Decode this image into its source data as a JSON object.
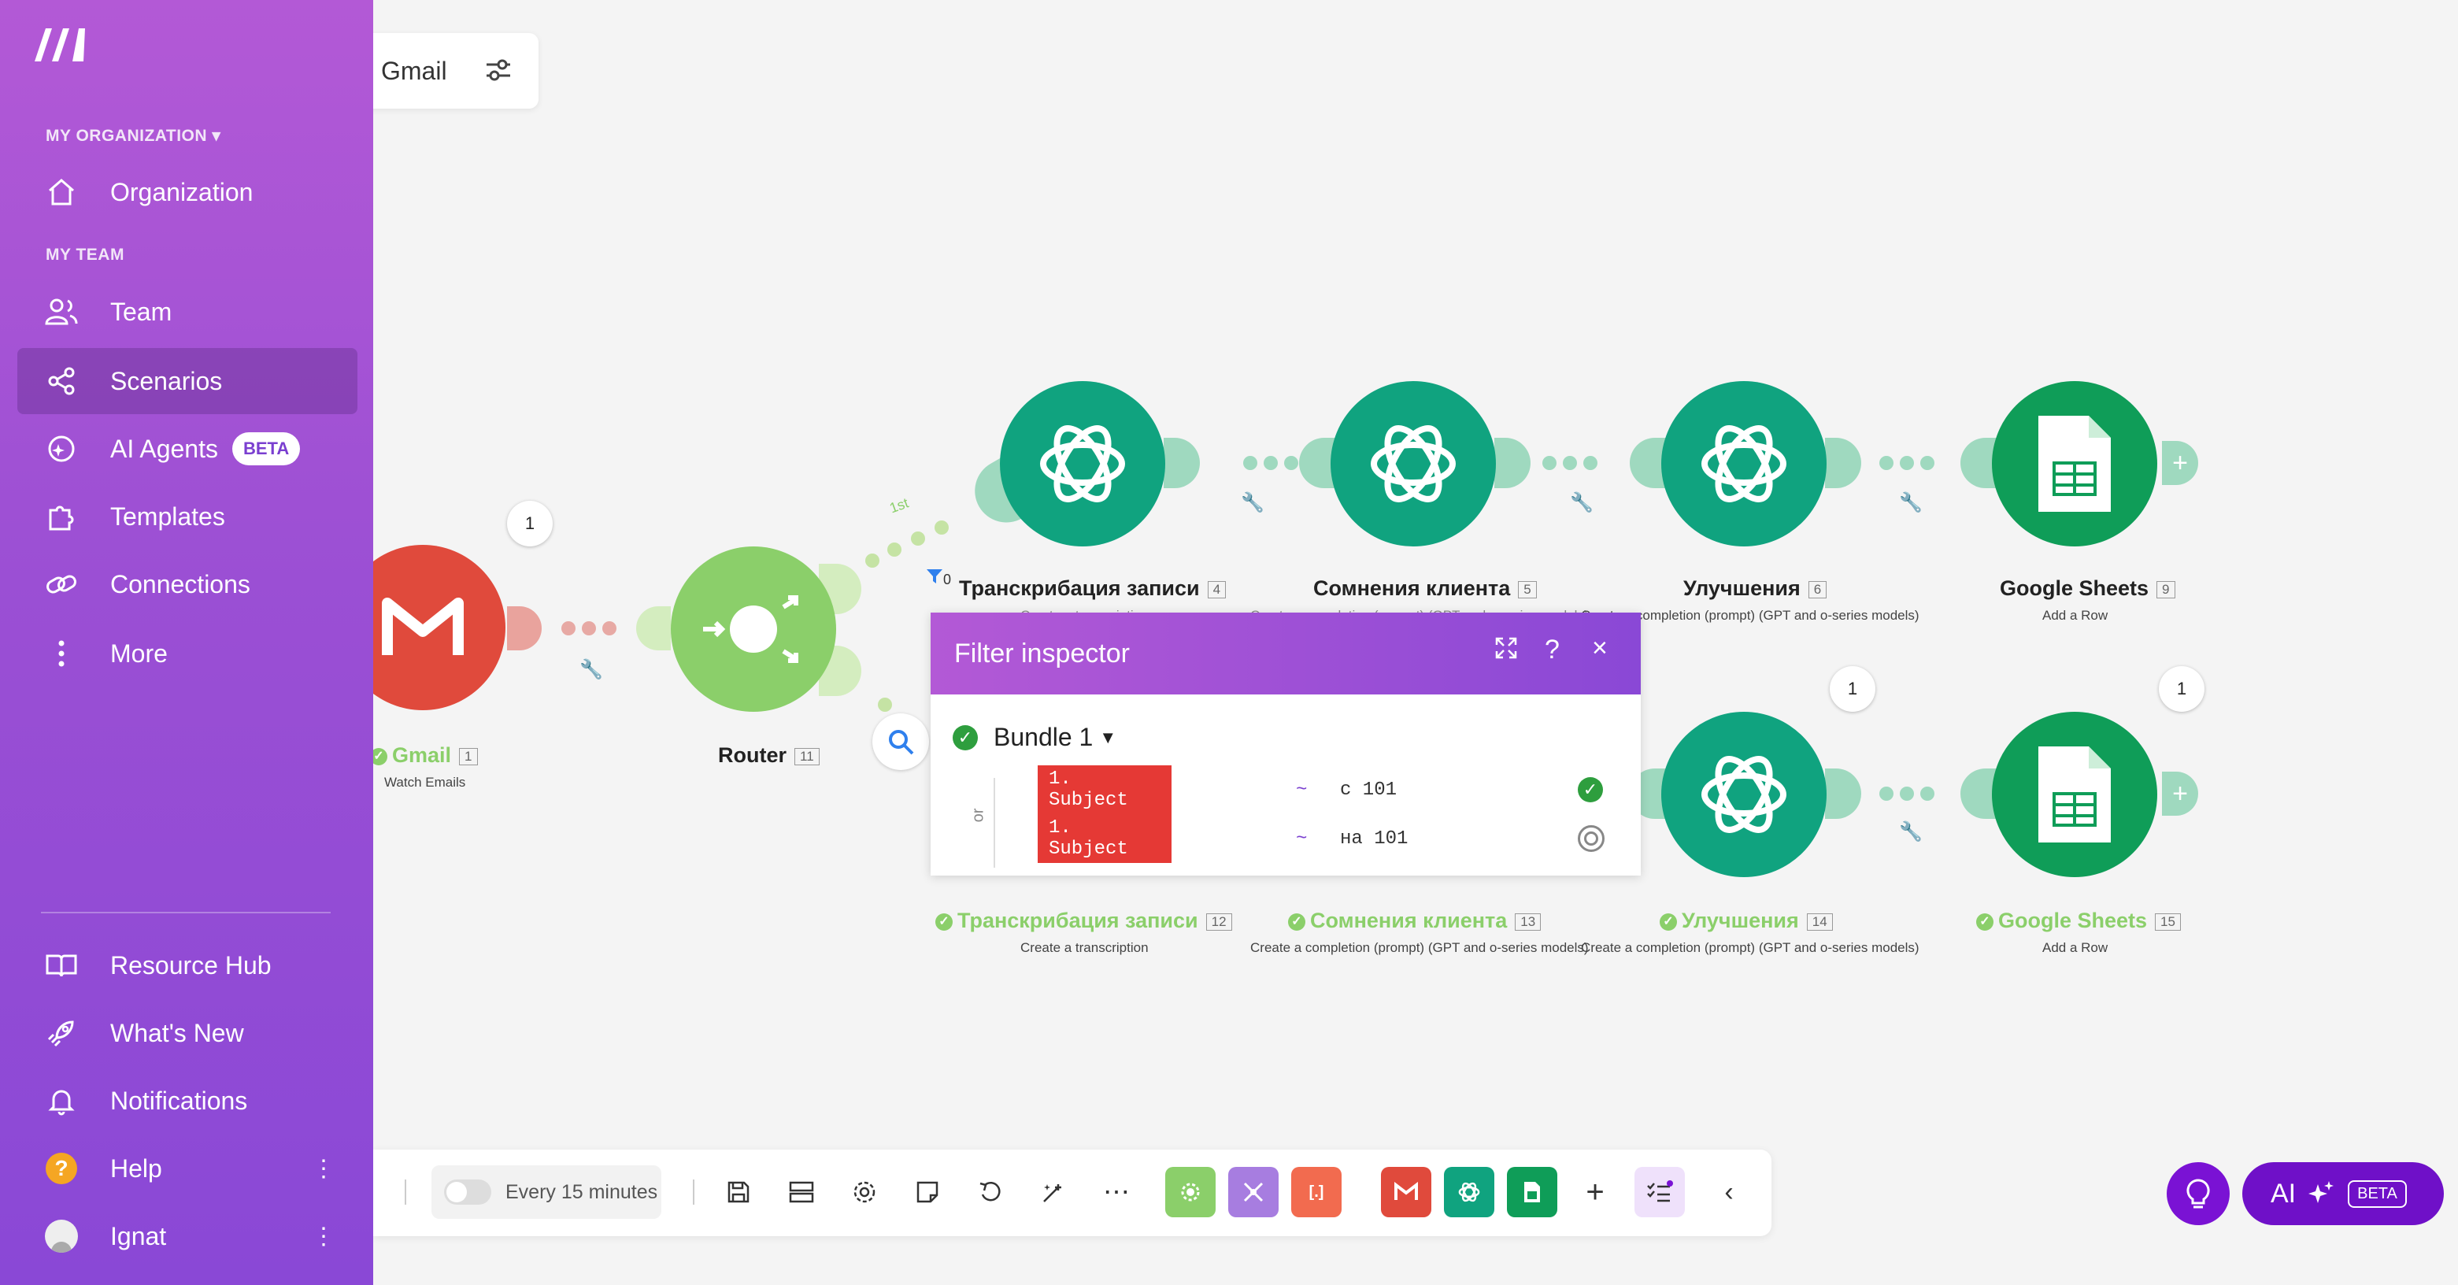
{
  "sidebar": {
    "org_section": "MY ORGANIZATION",
    "team_section": "MY TEAM",
    "items": [
      {
        "label": "Organization"
      },
      {
        "label": "Team"
      },
      {
        "label": "Scenarios"
      },
      {
        "label": "AI Agents",
        "badge": "BETA"
      },
      {
        "label": "Templates"
      },
      {
        "label": "Connections"
      },
      {
        "label": "More"
      }
    ],
    "bottom": [
      {
        "label": "Resource Hub"
      },
      {
        "label": "What's New"
      },
      {
        "label": "Notifications"
      },
      {
        "label": "Help"
      },
      {
        "label": "Ignat"
      }
    ]
  },
  "chip": {
    "label": "Gmail"
  },
  "nodes": {
    "gmail": {
      "title": "Gmail",
      "num": "1",
      "sub": "Watch Emails",
      "bubble": "1"
    },
    "router": {
      "title": "Router",
      "num": "11"
    },
    "top": [
      {
        "title": "Транскрибация записи",
        "num": "4",
        "sub": "Create a transcription"
      },
      {
        "title": "Сомнения клиента",
        "num": "5",
        "sub": "Create a completion (prompt) (GPT and o-series models)"
      },
      {
        "title": "Улучшения",
        "num": "6",
        "sub": "Create a completion (prompt) (GPT and o-series models)"
      },
      {
        "title": "Google Sheets",
        "num": "9",
        "sub": "Add a Row"
      }
    ],
    "bottom": [
      {
        "title": "Транскрибация записи",
        "num": "12",
        "sub": "Create a transcription"
      },
      {
        "title": "Сомнения клиента",
        "num": "13",
        "sub": "Create a completion (prompt) (GPT and o-series models)"
      },
      {
        "title": "Улучшения",
        "num": "14",
        "sub": "Create a completion (prompt) (GPT and o-series models)",
        "bubble": "1"
      },
      {
        "title": "Google Sheets",
        "num": "15",
        "sub": "Add a Row",
        "bubble": "1"
      }
    ],
    "route_label": "1st",
    "filter_count": "0"
  },
  "filter_inspector": {
    "title": "Filter inspector",
    "bundle": "Bundle 1",
    "or_label": "or",
    "conditions": [
      {
        "field": "1. Subject",
        "op": "~",
        "value": "с 101",
        "status": "passed"
      },
      {
        "field": "1. Subject",
        "op": "~",
        "value": "на 101",
        "status": "failed"
      }
    ]
  },
  "toolbar": {
    "schedule": "Every 15 minutes"
  },
  "ai_button": {
    "label": "AI",
    "badge": "BETA"
  },
  "colors": {
    "sidebar": "#9b4fd4",
    "openai": "#10a37f",
    "sheets": "#0f9d58",
    "gmail": "#ea4335",
    "router": "#8bcf6a"
  }
}
